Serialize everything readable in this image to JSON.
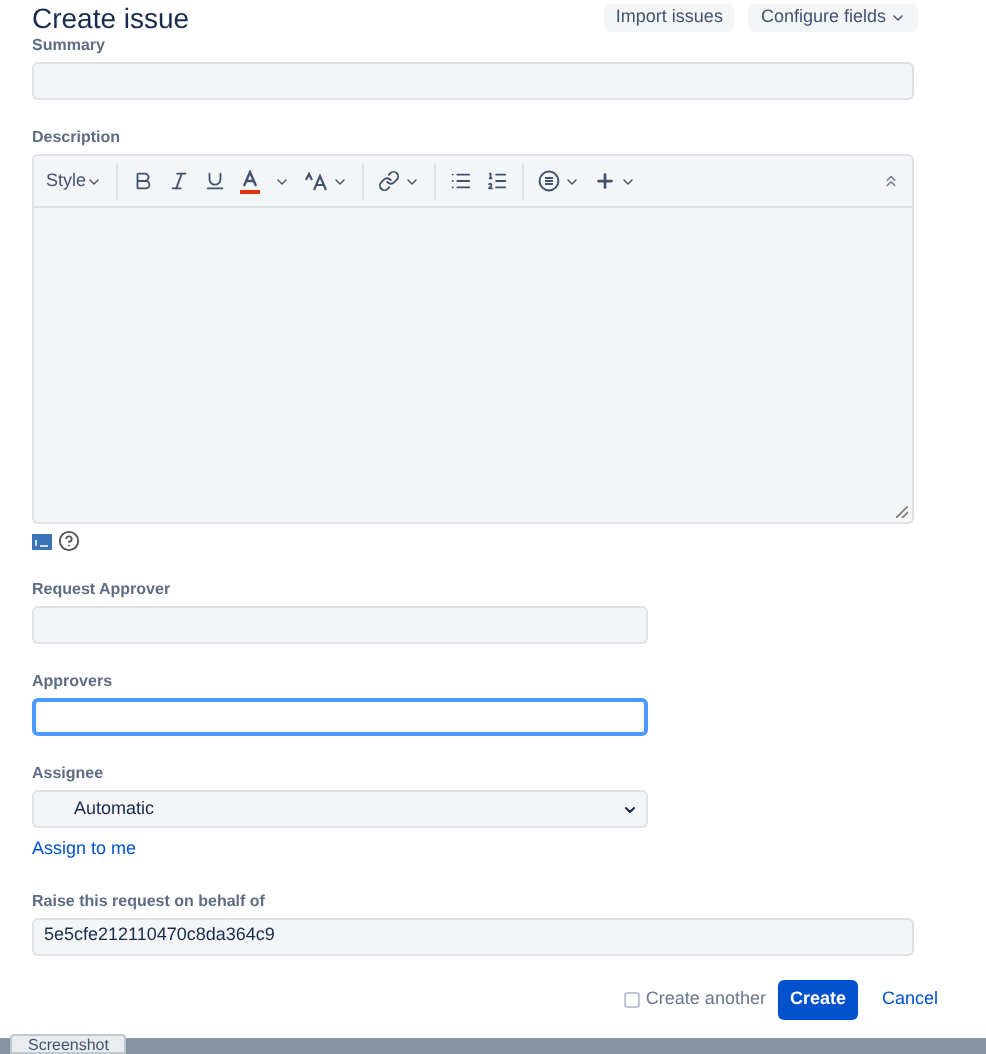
{
  "title": "Create issue",
  "header_buttons": [
    {
      "label": "Import issues",
      "kind": "plain"
    },
    {
      "label": "Configure fields",
      "kind": "dropdown"
    }
  ],
  "fields": [
    {
      "kind": "long_text",
      "label": "Summary",
      "focused": false
    },
    {
      "kind": "editor",
      "label": "Description",
      "style_label": "Style"
    },
    {
      "kind": "short_text",
      "label": "Request Approver",
      "focused": false
    },
    {
      "kind": "short_text",
      "label": "Approvers",
      "focused": true
    },
    {
      "kind": "select",
      "label": "Assignee",
      "value": "Automatic",
      "link": "Assign to me"
    },
    {
      "kind": "long_text",
      "label": "Raise this request on behalf of",
      "focused": false,
      "value": "5e5cfe212110470c8da364c9"
    }
  ],
  "create_another": {
    "label": "Create another",
    "checked": false
  },
  "footer_buttons": [
    {
      "label": "Create",
      "kind": "primary"
    },
    {
      "label": "Cancel",
      "kind": "link"
    }
  ],
  "bottom_tab": "Screenshot"
}
